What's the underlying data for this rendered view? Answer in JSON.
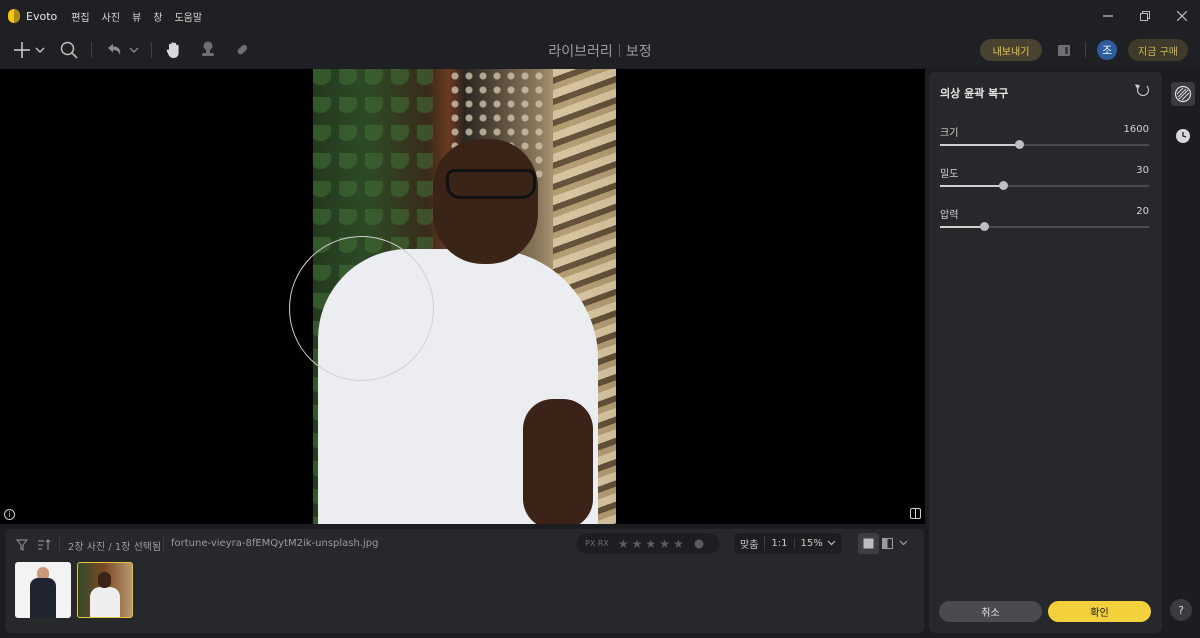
{
  "app": {
    "name": "Evoto",
    "menu": [
      "편집",
      "사진",
      "뷰",
      "창",
      "도움말"
    ]
  },
  "toolbar": {
    "mode_library": "라이브러리",
    "mode_edit": "보정",
    "export_label": "내보내기",
    "avatar_initial": "조",
    "buy_label": "지금 구매"
  },
  "filmstrip": {
    "count_text": "2장 사진 / 1장 선택됨",
    "filename": "fortune-vieyra-8fEMQytM2ik-unsplash.jpg",
    "flag_labels": "PX  RX",
    "stars": [
      "★",
      "★",
      "★",
      "★",
      "★"
    ],
    "zoom_fit": "맞춤",
    "zoom_one": "1:1",
    "zoom_value": "15%"
  },
  "panel": {
    "title": "의상 윤곽 복구",
    "sliders": [
      {
        "label": "크기",
        "value": "1600",
        "fraction": 0.38
      },
      {
        "label": "밀도",
        "value": "30",
        "fraction": 0.3
      },
      {
        "label": "압력",
        "value": "20",
        "fraction": 0.21
      }
    ],
    "cancel_label": "취소",
    "confirm_label": "확인"
  },
  "help_label": "?",
  "colors": {
    "accent": "#f2d13c",
    "panel_bg": "#27282c",
    "app_bg": "#1c1d20"
  }
}
